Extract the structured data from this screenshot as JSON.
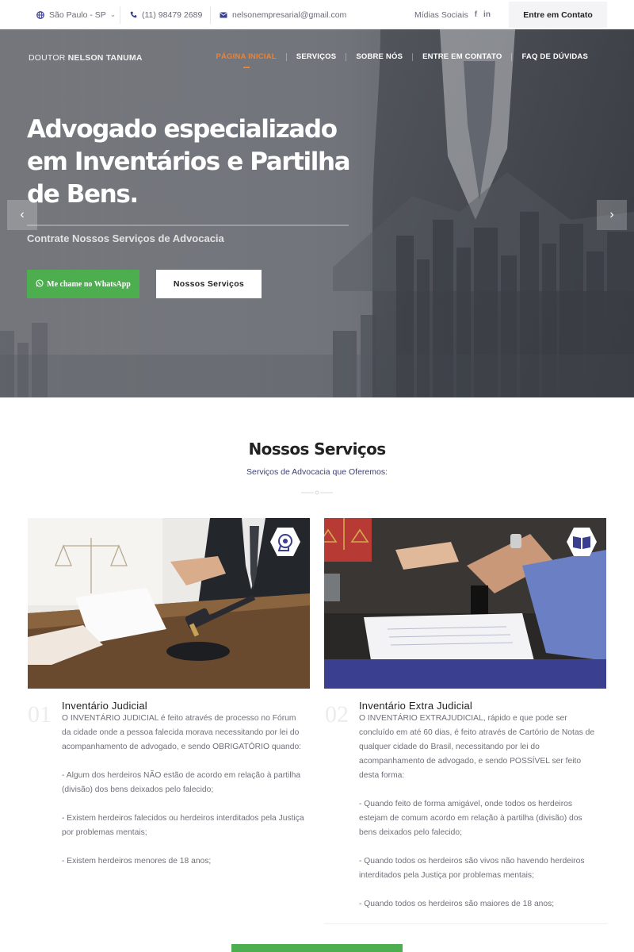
{
  "topbar": {
    "location": "São Paulo - SP",
    "phone": "(11) 98479 2689",
    "email": "nelsonempresarial@gmail.com",
    "social_label": "Mídias Sociais",
    "social_icons": [
      "f",
      "in"
    ],
    "cta": "Entre em Contato"
  },
  "brand": {
    "prefix": "DOUTOR",
    "name": "NELSON TANUMA"
  },
  "nav": {
    "items": [
      "PÁGINA INICIAL",
      "SERVIÇOS",
      "SOBRE NÓS",
      "ENTRE EM CONTATO",
      "FAQ DE DÚVIDAS"
    ],
    "active_index": 0,
    "active_color": "#e8833a"
  },
  "hero": {
    "title": "Advogado especializado em Inventários e Partilha de Bens.",
    "subtitle": "Contrate Nossos Serviços de Advocacia",
    "whatsapp_button": "Me chame no WhatsApp",
    "services_button": "Nossos Serviços",
    "prev_icon": "chevron-left-icon",
    "next_icon": "chevron-right-icon"
  },
  "services": {
    "title": "Nossos Serviços",
    "subtitle": "Serviços de Advocacia que Oferemos:",
    "cards": [
      {
        "number": "01",
        "title": "Inventário Judicial",
        "icon": "head-gear-icon",
        "paragraphs": [
          "O INVENTÁRIO JUDICIAL é feito através de processo no Fórum da cidade onde a pessoa falecida morava necessitando por lei do acompanhamento de advogado, e sendo OBRIGATÓRIO quando:",
          "- Algum dos herdeiros NÃO estão de acordo em relação à partilha (divisão) dos bens deixados pelo falecido;",
          "- Existem herdeiros falecidos ou herdeiros interditados pela Justiça por problemas mentais;",
          "- Existem herdeiros menores de 18 anos;"
        ]
      },
      {
        "number": "02",
        "title": "Inventário Extra Judicial",
        "icon": "book-icon",
        "paragraphs": [
          "O INVENTÁRIO EXTRAJUDICIAL, rápido e que pode ser concluído em até 60 dias, é feito através de Cartório de Notas de qualquer cidade do Brasil, necessitando por lei do acompanhamento de advogado, e sendo POSSÍVEL ser feito desta forma:",
          "- Quando feito de forma amigável, onde todos os herdeiros estejam de comum acordo em relação à partilha (divisão) dos bens deixados pelo falecido;",
          "- Quando todos os herdeiros são vivos não havendo herdeiros interditados pela Justiça por problemas mentais;",
          "- Quando todos os herdeiros são maiores de 18 anos;"
        ]
      }
    ]
  },
  "colors": {
    "accent_green": "#4cae4f",
    "navy": "#3a3f8f",
    "orange": "#e8833a"
  }
}
